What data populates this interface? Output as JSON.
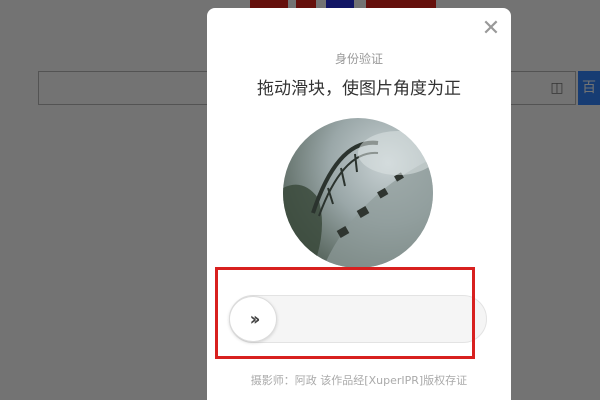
{
  "dialog": {
    "subtitle": "身份验证",
    "title": "拖动滑块，使图片角度为正",
    "close_icon": "close-icon",
    "handle_icon": "double-chevron-right-icon",
    "handle_glyph": "››",
    "footer": "摄影师：阿政 该作品经[XuperIPR]版权存证",
    "slider_progress": 0
  },
  "background": {
    "search_button_label": "百",
    "camera_icon": "camera-icon",
    "accent": "#3385ff"
  },
  "colors": {
    "highlight": "#d8201f",
    "overlay": "rgba(0,0,0,0.55)"
  }
}
